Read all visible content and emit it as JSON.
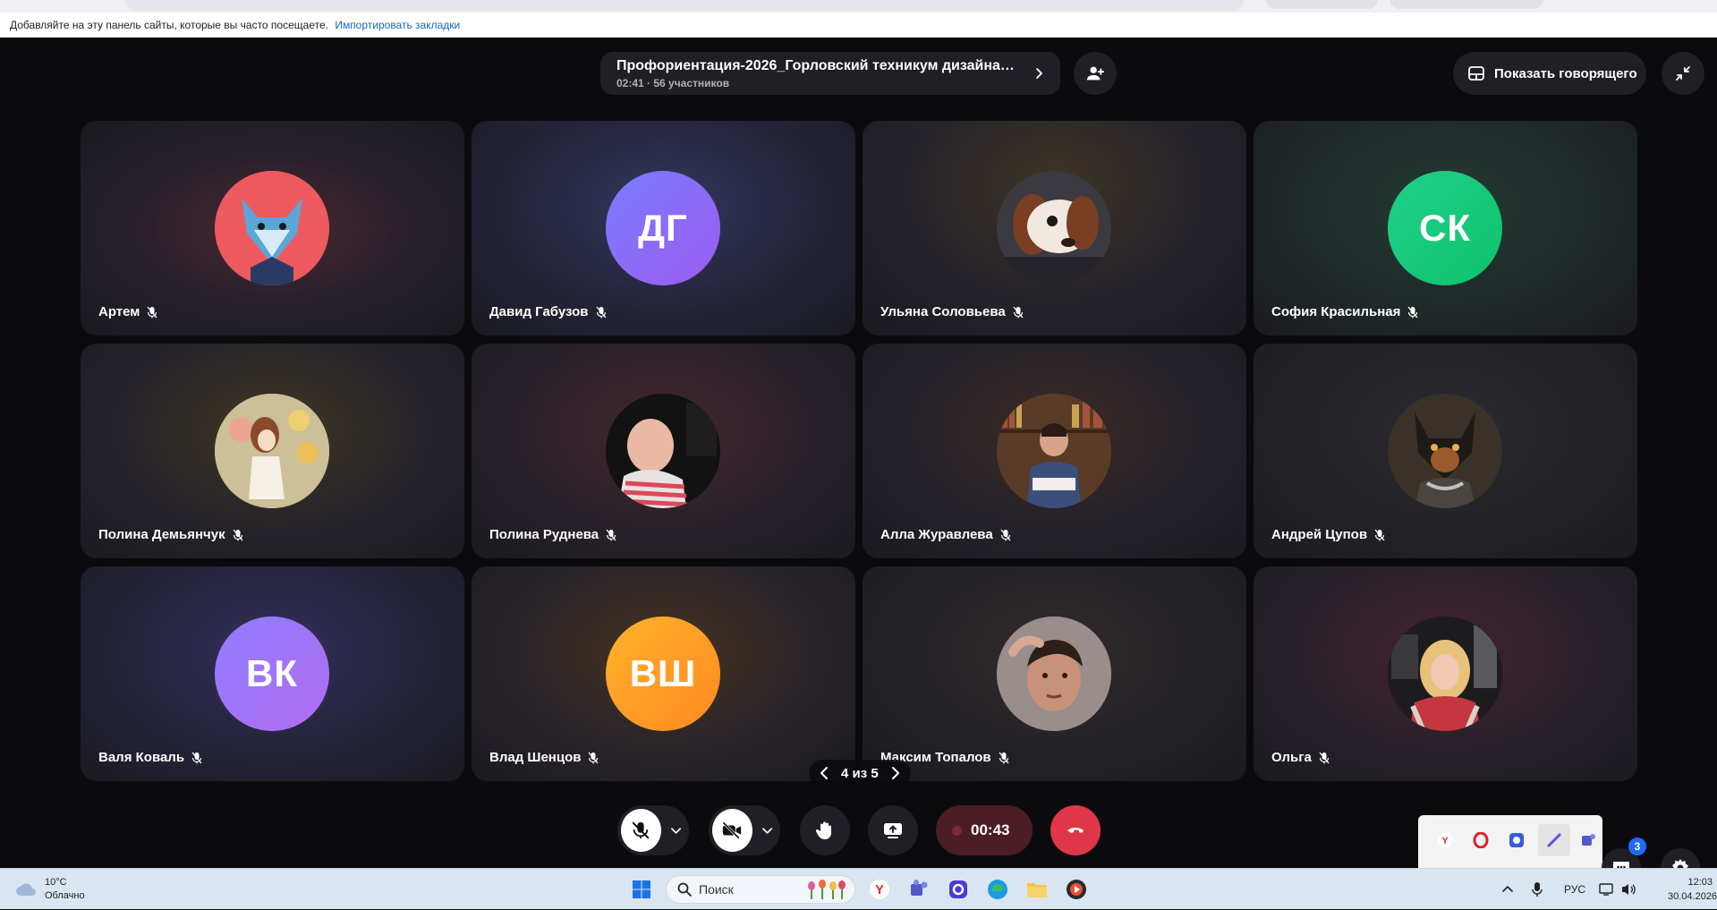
{
  "browser": {
    "bookmarks_hint": "Добавляйте на эту панель сайты, которые вы часто посещаете.",
    "import_link": "Импортировать закладки"
  },
  "meeting": {
    "title": "Профориентация-2026_Горловский техникум дизайна и ...",
    "subtitle": "02:41 · 56 участников",
    "show_speaker_label": "Показать говорящего",
    "pager": "4 из 5",
    "record_time": "00:43",
    "chat_badge": "3"
  },
  "participants": [
    {
      "name": "Артем",
      "initials": "",
      "photo": "wolf"
    },
    {
      "name": "Давид Габузов",
      "initials": "ДГ",
      "photo": ""
    },
    {
      "name": "Ульяна Соловьева",
      "initials": "",
      "photo": "puppy"
    },
    {
      "name": "София Красильная",
      "initials": "СК",
      "photo": ""
    },
    {
      "name": "Полина Демьянчук",
      "initials": "",
      "photo": "anime"
    },
    {
      "name": "Полина Руднева",
      "initials": "",
      "photo": "girl"
    },
    {
      "name": "Алла Журавлева",
      "initials": "",
      "photo": "library"
    },
    {
      "name": "Андрей Цупов",
      "initials": "",
      "photo": "dog"
    },
    {
      "name": "Валя Коваль",
      "initials": "ВК",
      "photo": ""
    },
    {
      "name": "Влад Шенцов",
      "initials": "ВШ",
      "photo": ""
    },
    {
      "name": "Максим Топалов",
      "initials": "",
      "photo": "boy"
    },
    {
      "name": "Ольга",
      "initials": "",
      "photo": "blonde"
    }
  ],
  "taskbar": {
    "temperature": "10°C",
    "weather": "Облачно",
    "search_placeholder": "Поиск",
    "language": "РУС",
    "time": "12:03",
    "date": "30.04.2026"
  },
  "colors": {
    "background": "#0b0b0e",
    "panel": "#1f1f25",
    "end_call": "#e0364a",
    "record_bg": "#4a1e24",
    "badge": "#1f6bff"
  }
}
